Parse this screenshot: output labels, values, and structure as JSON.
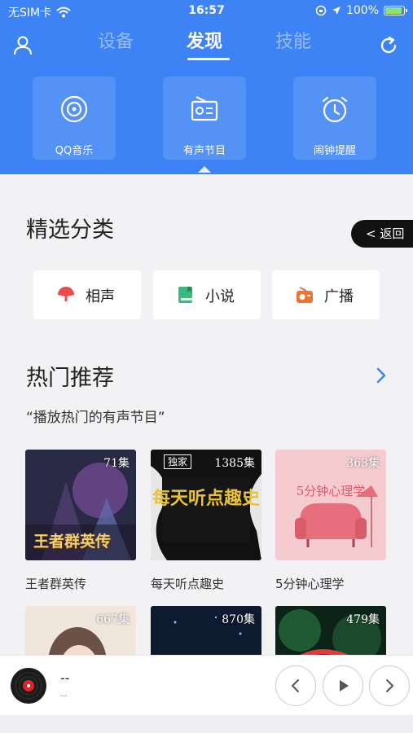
{
  "status_bar": {
    "carrier": "无SIM卡",
    "time": "16:57",
    "battery": "100%",
    "battery_level": 1.0
  },
  "header": {
    "tabs": [
      {
        "label": "设备",
        "active": false
      },
      {
        "label": "发现",
        "active": true
      },
      {
        "label": "技能",
        "active": false
      }
    ],
    "icons": {
      "left": "user-icon",
      "right": "refresh-icon"
    }
  },
  "quick_cards": [
    {
      "label": "QQ音乐",
      "icon": "disc-icon"
    },
    {
      "label": "有声节目",
      "icon": "radio-icon"
    },
    {
      "label": "闹钟提醒",
      "icon": "alarm-icon"
    }
  ],
  "featured": {
    "title": "精选分类",
    "back_label": "< 返回",
    "categories": [
      {
        "label": "相声",
        "icon": "fan-icon",
        "color": "#e94b4b"
      },
      {
        "label": "小说",
        "icon": "book-icon",
        "color": "#3bb980"
      },
      {
        "label": "广播",
        "icon": "radio-icon",
        "color": "#f0742f"
      }
    ]
  },
  "hot": {
    "title": "热门推荐",
    "subtitle": "“播放热门的有声节目”",
    "items": [
      {
        "title": "王者群英传",
        "count": "71集",
        "cover_text": "王者群英传",
        "colors": [
          "#2a2a46",
          "#7a4f9a",
          "#c9a85a"
        ]
      },
      {
        "title": "每天听点趣史",
        "count": "1385集",
        "cover_text": "每天听点趣史",
        "badge": "独家",
        "colors": [
          "#111111",
          "#1d1d1d",
          "#e8c23a"
        ]
      },
      {
        "title": "5分钟心理学",
        "count": "363集",
        "cover_text": "5分钟心理学",
        "colors": [
          "#f6cbd0",
          "#f0b6bd",
          "#e76f7d"
        ]
      },
      {
        "title": "",
        "count": "667集",
        "colors": [
          "#f0e6dc",
          "#c9b4a6",
          "#6b5146"
        ]
      },
      {
        "title": "",
        "count": "870集",
        "colors": [
          "#0e1a30",
          "#243a68",
          "#5f84c8"
        ]
      },
      {
        "title": "",
        "count": "479集",
        "colors": [
          "#0c2418",
          "#1f5a34",
          "#e13b3b"
        ]
      }
    ]
  },
  "player": {
    "title": "--",
    "subtitle": "--"
  }
}
